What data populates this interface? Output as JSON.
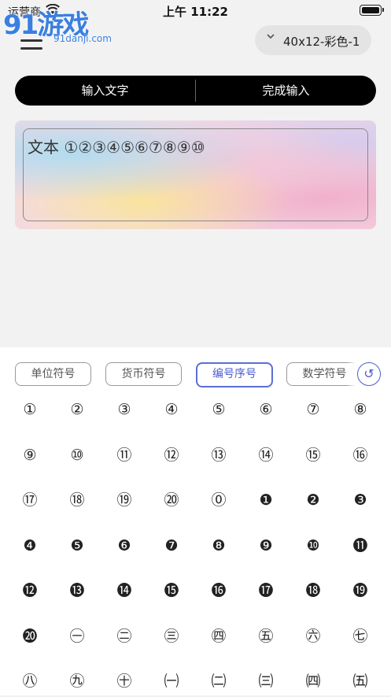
{
  "status_bar": {
    "carrier": "运营商",
    "time": "上午 11:22"
  },
  "watermark": {
    "logo_text": "91游戏",
    "site": "91danji.com"
  },
  "size_selector": {
    "value": "40x12-彩色-1",
    "icon": "chevron-down-icon"
  },
  "actions": {
    "input_text": "输入文字",
    "done_input": "完成输入"
  },
  "preview": {
    "text": "文本 ①②③④⑤⑥⑦⑧⑨⑩"
  },
  "categories": [
    {
      "label": "单位符号",
      "active": false
    },
    {
      "label": "货币符号",
      "active": false
    },
    {
      "label": "编号序号",
      "active": true
    },
    {
      "label": "数学符号",
      "active": false
    }
  ],
  "undo": {
    "icon": "undo-icon",
    "glyph": "↺"
  },
  "colors": {
    "accent": "#4c5ed0",
    "action_bar": "#000000"
  },
  "symbols": [
    [
      "①",
      "②",
      "③",
      "④",
      "⑤",
      "⑥",
      "⑦",
      "⑧"
    ],
    [
      "⑨",
      "⑩",
      "⑪",
      "⑫",
      "⑬",
      "⑭",
      "⑮",
      "⑯"
    ],
    [
      "⑰",
      "⑱",
      "⑲",
      "⑳",
      "⓪",
      "❶",
      "❷",
      "❸"
    ],
    [
      "❹",
      "❺",
      "❻",
      "❼",
      "❽",
      "❾",
      "❿",
      "⓫"
    ],
    [
      "⓬",
      "⓭",
      "⓮",
      "⓯",
      "⓰",
      "⓱",
      "⓲",
      "⓳"
    ],
    [
      "⓴",
      "㊀",
      "㊁",
      "㊂",
      "㊃",
      "㊄",
      "㊅",
      "㊆"
    ],
    [
      "㊇",
      "㊈",
      "㊉",
      "㈠",
      "㈡",
      "㈢",
      "㈣",
      "㈤"
    ]
  ]
}
